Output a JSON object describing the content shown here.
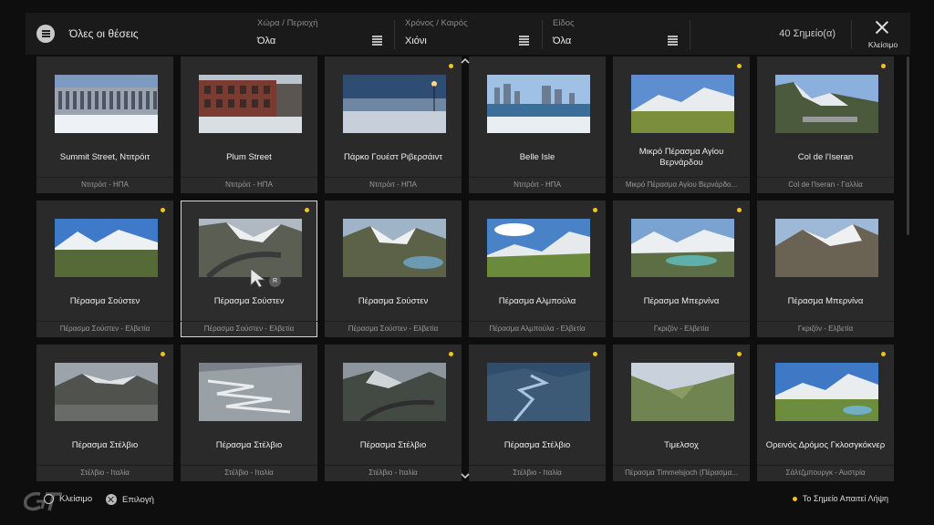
{
  "header": {
    "title": "Όλες οι θέσεις",
    "filters": [
      {
        "label": "Χώρα / Περιοχή",
        "value": "Όλα"
      },
      {
        "label": "Χρόνος / Καιρός",
        "value": "Χιόνι"
      },
      {
        "label": "Είδος",
        "value": "Όλα"
      }
    ],
    "count": "40 Σημείο(α)",
    "close_label": "Κλείσιμο"
  },
  "cards": [
    {
      "title": "Summit Street, Ντιτρόιτ",
      "subtitle": "Ντιτρόιτ - ΗΠΑ",
      "dot": false,
      "thumb": "warehouse"
    },
    {
      "title": "Plum Street",
      "subtitle": "Ντιτρόιτ - ΗΠΑ",
      "dot": false,
      "thumb": "brick"
    },
    {
      "title": "Πάρκο Γουέστ Ριβερσάιντ",
      "subtitle": "Ντιτρόιτ - ΗΠΑ",
      "dot": true,
      "thumb": "riverside"
    },
    {
      "title": "Belle Isle",
      "subtitle": "Ντιτρόιτ - ΗΠΑ",
      "dot": false,
      "thumb": "skyline"
    },
    {
      "title": "Μικρό Πέρασμα Αγίου Βερνάρδου",
      "subtitle": "Μικρό Πέρασμα Αγίου Βερνάρδο...",
      "dot": true,
      "thumb": "alp1"
    },
    {
      "title": "Col de l'Iseran",
      "subtitle": "Col de l'Iseran - Γαλλία",
      "dot": true,
      "thumb": "alp2"
    },
    {
      "title": "Πέρασμα Σούστεν",
      "subtitle": "Πέρασμα Σούστεν - Ελβετία",
      "dot": true,
      "thumb": "alp3"
    },
    {
      "title": "Πέρασμα Σούστεν",
      "subtitle": "Πέρασμα Σούστεν - Ελβετία",
      "dot": true,
      "thumb": "road1",
      "selected": true
    },
    {
      "title": "Πέρασμα Σούστεν",
      "subtitle": "Πέρασμα Σούστεν - Ελβετία",
      "dot": false,
      "thumb": "lake1"
    },
    {
      "title": "Πέρασμα Αλμπούλα",
      "subtitle": "Πέρασμα Αλμπούλα - Ελβετία",
      "dot": true,
      "thumb": "alp4"
    },
    {
      "title": "Πέρασμα Μπερνίνα",
      "subtitle": "Γκριζόν - Ελβετία",
      "dot": true,
      "thumb": "lake2"
    },
    {
      "title": "Πέρασμα Μπερνίνα",
      "subtitle": "Γκριζόν - Ελβετία",
      "dot": false,
      "thumb": "alp5"
    },
    {
      "title": "Πέρασμα Στέλβιο",
      "subtitle": "Στέλβιο - Ιταλία",
      "dot": true,
      "thumb": "grey1"
    },
    {
      "title": "Πέρασμα Στέλβιο",
      "subtitle": "Στέλβιο - Ιταλία",
      "dot": false,
      "thumb": "grey2"
    },
    {
      "title": "Πέρασμα Στέλβιο",
      "subtitle": "Στέλβιο - Ιταλία",
      "dot": true,
      "thumb": "grey3"
    },
    {
      "title": "Πέρασμα Στέλβιο",
      "subtitle": "Στέλβιο - Ιταλία",
      "dot": true,
      "thumb": "blue1"
    },
    {
      "title": "Τιμελσοχ",
      "subtitle": "Πέρασμα Timmelsjoch (Πέρασμα...",
      "dot": true,
      "thumb": "valley"
    },
    {
      "title": "Ορεινός Δρόμος Γκλοσγκόκνερ",
      "subtitle": "Σάλτζμπουργκ - Αυστρία",
      "dot": true,
      "thumb": "alp6"
    }
  ],
  "cursor_badge": "R",
  "footer": {
    "back_label": "Κλείσιμο",
    "select_label": "Επιλογή",
    "legend": "Το Σημείο Απαιτεί Λήψη"
  },
  "colors": {
    "accent_dot": "#f1c21b",
    "card_bg": "#2a2a2a",
    "page_bg": "#0e0e0e"
  }
}
